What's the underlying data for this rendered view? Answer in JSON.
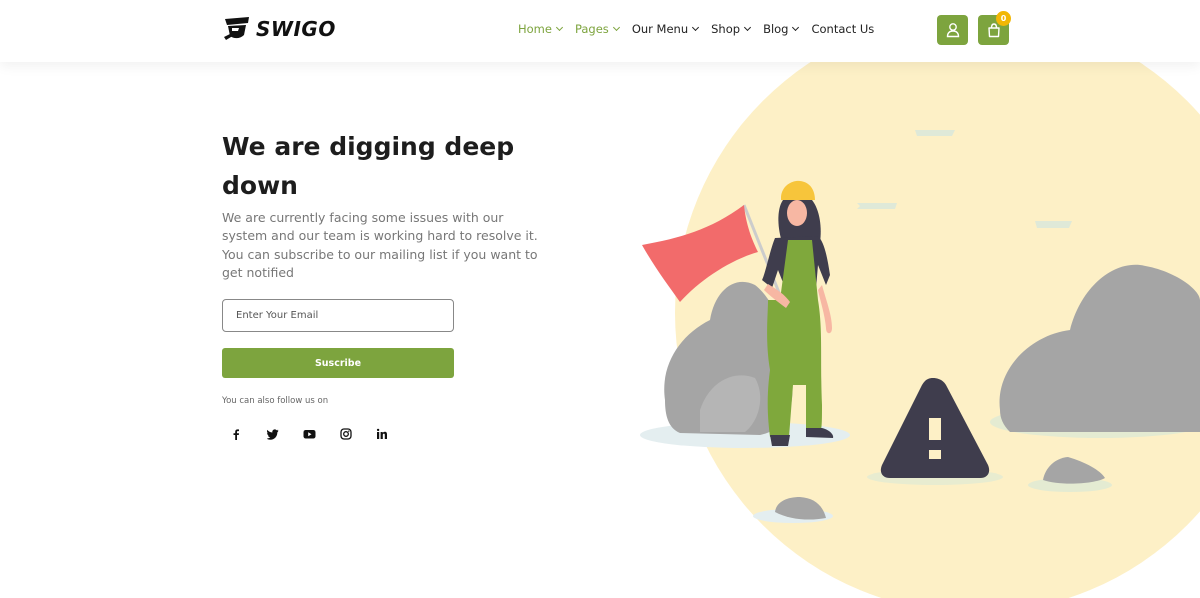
{
  "brand": {
    "name": "SWIGO",
    "accent": "#7da43e",
    "badge_color": "#f2b705"
  },
  "nav": {
    "items": [
      {
        "label": "Home",
        "has_dropdown": true,
        "active": true
      },
      {
        "label": "Pages",
        "has_dropdown": true,
        "active": true
      },
      {
        "label": "Our Menu",
        "has_dropdown": true,
        "active": false
      },
      {
        "label": "Shop",
        "has_dropdown": true,
        "active": false
      },
      {
        "label": "Blog",
        "has_dropdown": true,
        "active": false
      },
      {
        "label": "Contact Us",
        "has_dropdown": false,
        "active": false
      }
    ]
  },
  "header_actions": {
    "user_icon": "user-icon",
    "cart_icon": "shopping-bag-icon",
    "cart_count": "0"
  },
  "hero": {
    "title": "We are digging deep down",
    "description": "We are currently facing some issues with our system and our team is working hard to resolve it. You can subscribe to our mailing list if you want to get notified"
  },
  "subscribe": {
    "placeholder": "Enter Your Email",
    "button_label": "Suscribe"
  },
  "social": {
    "label": "You can also follow us on",
    "icons": [
      "facebook-icon",
      "twitter-icon",
      "youtube-icon",
      "instagram-icon",
      "linkedin-icon"
    ]
  }
}
